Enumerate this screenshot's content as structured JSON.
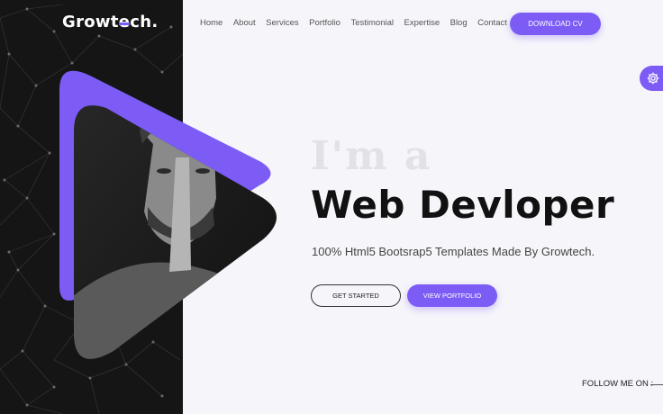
{
  "brand": {
    "name_prefix": "Growt",
    "name_e": "e",
    "name_suffix": "ch",
    "name_dot": "."
  },
  "nav": {
    "items": [
      "Home",
      "About",
      "Services",
      "Portfolio",
      "Testimonial",
      "Expertise",
      "Blog",
      "Contact"
    ],
    "download_label": "DOWNLOAD CV"
  },
  "hero": {
    "intro": "I'm a",
    "role": "Web Devloper",
    "tagline": "100% Html5 Bootsrap5 Templates Made By Growtech.",
    "get_started_label": "GET STARTED",
    "view_portfolio_label": "VIEW PORTFOLIO"
  },
  "social": {
    "follow_label": "FOLLOW ME ON :"
  },
  "colors": {
    "accent": "#7c5cf5",
    "dark": "#151515",
    "background": "#f6f5fa"
  },
  "icons": {
    "settings": "gear-icon"
  }
}
